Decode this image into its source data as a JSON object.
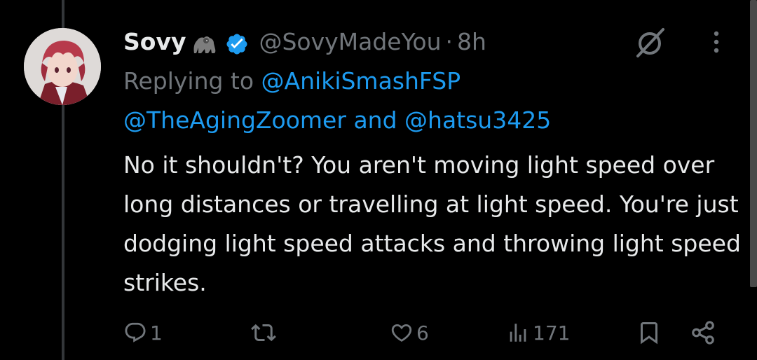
{
  "tweet": {
    "display_name": "Sovy",
    "name_emoji": "gorilla-emoji",
    "verified": true,
    "handle": "@SovyMadeYou",
    "separator": "·",
    "time": "8h",
    "replying_prefix": "Replying to",
    "replying_to": [
      "@AnikiSmashFSP",
      "@TheAgingZoomer",
      "@hatsu3425"
    ],
    "replying_and": "and",
    "text": "No it shouldn't? You aren't moving light speed over long distances or travelling at light speed. You're just dodging light speed attacks and throwing light speed strikes."
  },
  "actions": {
    "replies": "1",
    "retweets": "",
    "likes": "6",
    "views": "171"
  },
  "icons": {
    "verified": "verified-badge-icon",
    "grok": "grok-icon",
    "more": "more-options-icon",
    "reply": "reply-icon",
    "retweet": "retweet-icon",
    "like": "like-icon",
    "views": "views-icon",
    "bookmark": "bookmark-icon",
    "share": "share-icon"
  },
  "colors": {
    "background": "#000000",
    "text": "#e7e9ea",
    "secondary": "#71767b",
    "link": "#1d9bf0",
    "verified": "#1d9bf0"
  }
}
